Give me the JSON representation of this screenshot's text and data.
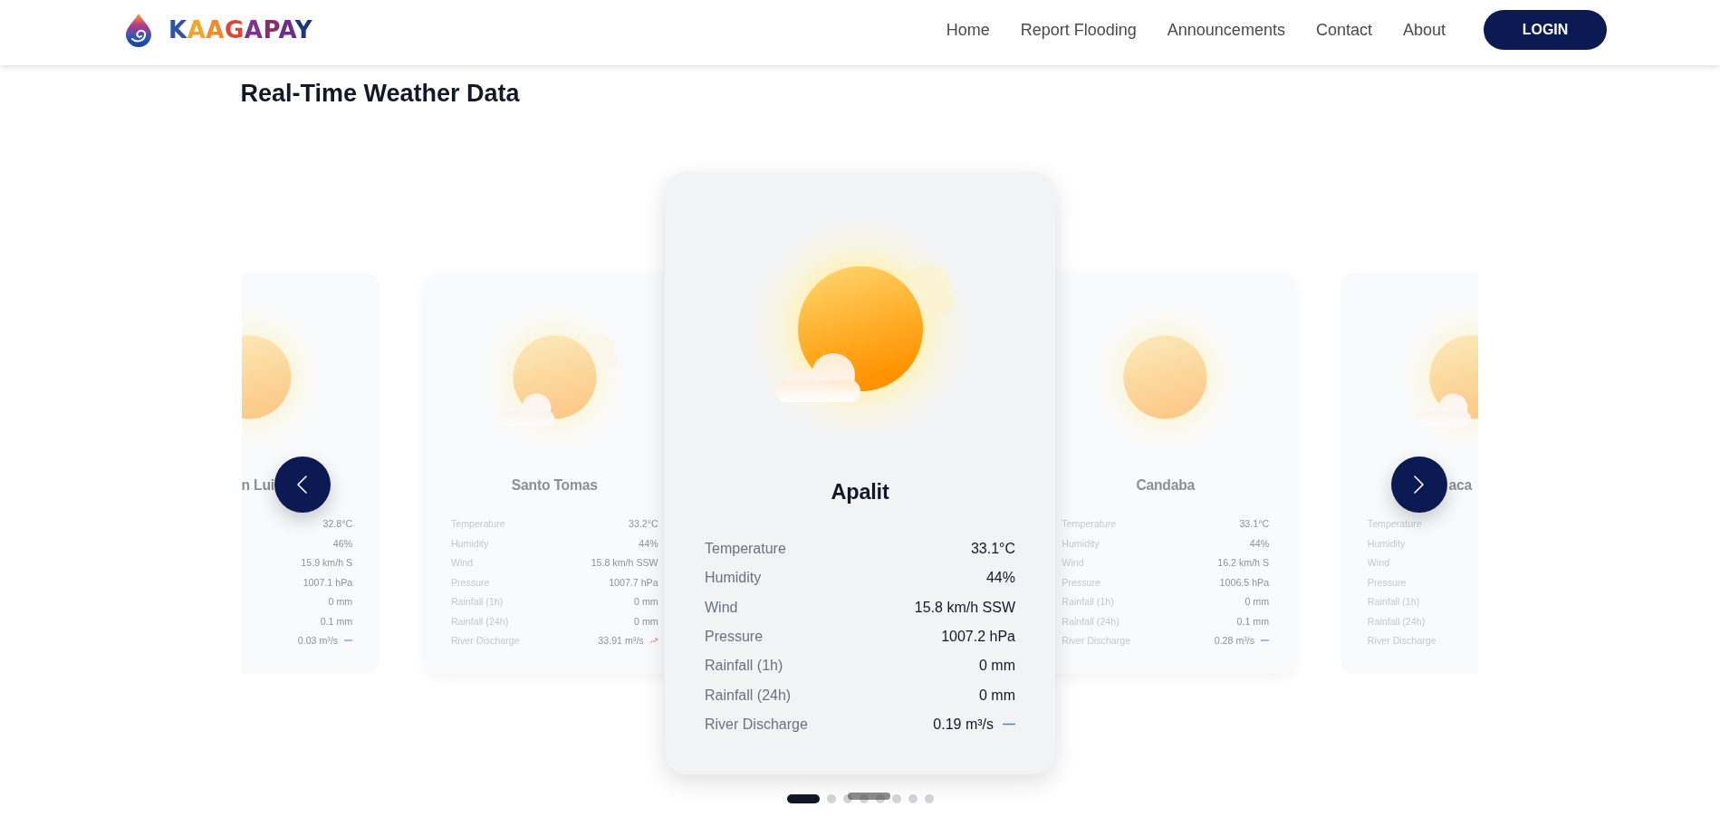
{
  "header": {
    "brand": "KAAGAPAY",
    "nav": [
      "Home",
      "Report Flooding",
      "Announcements",
      "Contact",
      "About"
    ],
    "login": "LOGIN"
  },
  "section_title": "Real-Time Weather Data",
  "stations": [
    {
      "name": "n Lui",
      "selected": false,
      "kind": "sunny",
      "readings": [
        {
          "kind": "plain",
          "value": "32.8°C"
        },
        {
          "kind": "plain",
          "value": "46%"
        },
        {
          "kind": "plain",
          "value": "15.9 km/h S"
        },
        {
          "kind": "plain",
          "value": "1007.1 hPa"
        },
        {
          "kind": "plain",
          "value": "0 mm"
        },
        {
          "kind": "plain",
          "value": "0.1 mm"
        },
        {
          "kind": "steady",
          "value": "0.03 m³/s"
        }
      ]
    },
    {
      "name": "Santo Tomas",
      "selected": false,
      "kind": "partlycloudy",
      "readings": [
        {
          "kind": "plain",
          "label": "Temperature",
          "value": "33.2°C"
        },
        {
          "kind": "plain",
          "label": "Humidity",
          "value": "44%"
        },
        {
          "kind": "plain",
          "label": "Wind",
          "value": "15.8 km/h SSW"
        },
        {
          "kind": "plain",
          "label": "Pressure",
          "value": "1007.7 hPa"
        },
        {
          "kind": "plain",
          "label": "Rainfall (1h)",
          "value": "0 mm"
        },
        {
          "kind": "plain",
          "label": "Rainfall (24h)",
          "value": "0 mm"
        },
        {
          "kind": "rising",
          "label": "River Discharge",
          "value": "33.91 m³/s"
        }
      ]
    },
    {
      "name": "Apalit",
      "selected": true,
      "kind": "partlycloudy",
      "readings": [
        {
          "kind": "plain",
          "label": "Temperature",
          "value": "33.1°C"
        },
        {
          "kind": "plain",
          "label": "Humidity",
          "value": "44%"
        },
        {
          "kind": "plain",
          "label": "Wind",
          "value": "15.8 km/h SSW"
        },
        {
          "kind": "plain",
          "label": "Pressure",
          "value": "1007.2 hPa"
        },
        {
          "kind": "plain",
          "label": "Rainfall (1h)",
          "value": "0 mm"
        },
        {
          "kind": "plain",
          "label": "Rainfall (24h)",
          "value": "0 mm"
        },
        {
          "kind": "steady",
          "label": "River Discharge",
          "value": "0.19 m³/s"
        }
      ]
    },
    {
      "name": "Candaba",
      "selected": false,
      "kind": "sunny",
      "readings": [
        {
          "kind": "plain",
          "label": "Temperature",
          "value": "33.1°C"
        },
        {
          "kind": "plain",
          "label": "Humidity",
          "value": "44%"
        },
        {
          "kind": "plain",
          "label": "Wind",
          "value": "16.2 km/h S"
        },
        {
          "kind": "plain",
          "label": "Pressure",
          "value": "1006.5 hPa"
        },
        {
          "kind": "plain",
          "label": "Rainfall (1h)",
          "value": "0 mm"
        },
        {
          "kind": "plain",
          "label": "Rainfall (24h)",
          "value": "0.1 mm"
        },
        {
          "kind": "steady",
          "label": "River Discharge",
          "value": "0.28 m³/s"
        }
      ]
    },
    {
      "name": "aca",
      "selected": false,
      "kind": "partlycloudy",
      "readings": [
        {
          "kind": "plain",
          "label": "Temperature"
        },
        {
          "kind": "plain",
          "label": "Humidity"
        },
        {
          "kind": "plain",
          "label": "Wind"
        },
        {
          "kind": "plain",
          "label": "Pressure"
        },
        {
          "kind": "plain",
          "label": "Rainfall (1h)"
        },
        {
          "kind": "plain",
          "label": "Rainfall (24h)"
        },
        {
          "kind": "plain",
          "label": "River Discharge"
        }
      ]
    }
  ],
  "pagination": [
    {
      "selected": true
    },
    {
      "selected": false
    },
    {
      "selected": false
    },
    {
      "selected": false
    },
    {
      "selected": false
    },
    {
      "selected": false
    },
    {
      "selected": false
    },
    {
      "selected": false
    }
  ]
}
